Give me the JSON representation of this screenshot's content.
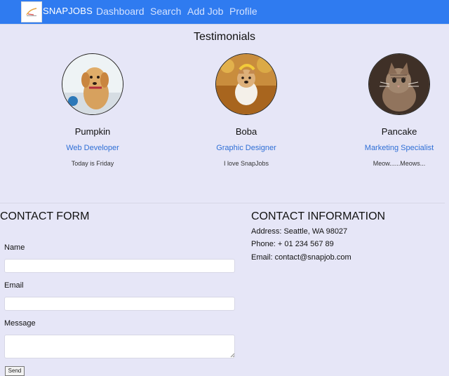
{
  "navbar": {
    "brand": "SNAPJOBS",
    "links": [
      "Dashboard",
      "Search",
      "Add Job",
      "Profile"
    ],
    "logo_icon": "snapjobs-logo-icon"
  },
  "testimonials": {
    "title": "Testimonials",
    "people": [
      {
        "name": "Pumpkin",
        "role": "Web Developer",
        "quote": "Today is Friday",
        "avatar_icon": "golden-retriever-puppy-icon"
      },
      {
        "name": "Boba",
        "role": "Graphic Designer",
        "quote": "I love SnapJobs",
        "avatar_icon": "corgi-leaves-icon"
      },
      {
        "name": "Pancake",
        "role": "Marketing Specialist",
        "quote": "Meow......Meows...",
        "avatar_icon": "tabby-cat-icon"
      }
    ]
  },
  "contact_form": {
    "title": "CONTACT FORM",
    "name_label": "Name",
    "email_label": "Email",
    "message_label": "Message",
    "name_value": "",
    "email_value": "",
    "message_value": "",
    "send_label": "Send"
  },
  "contact_info": {
    "title": "CONTACT INFORMATION",
    "address": "Address: Seattle, WA 98027",
    "phone": "Phone: + 01 234 567 89",
    "email": "Email: contact@snapjob.com"
  },
  "colors": {
    "nav_bg": "#2f7bf0",
    "page_bg": "#e6e6f7",
    "accent": "#2f6fd6"
  }
}
